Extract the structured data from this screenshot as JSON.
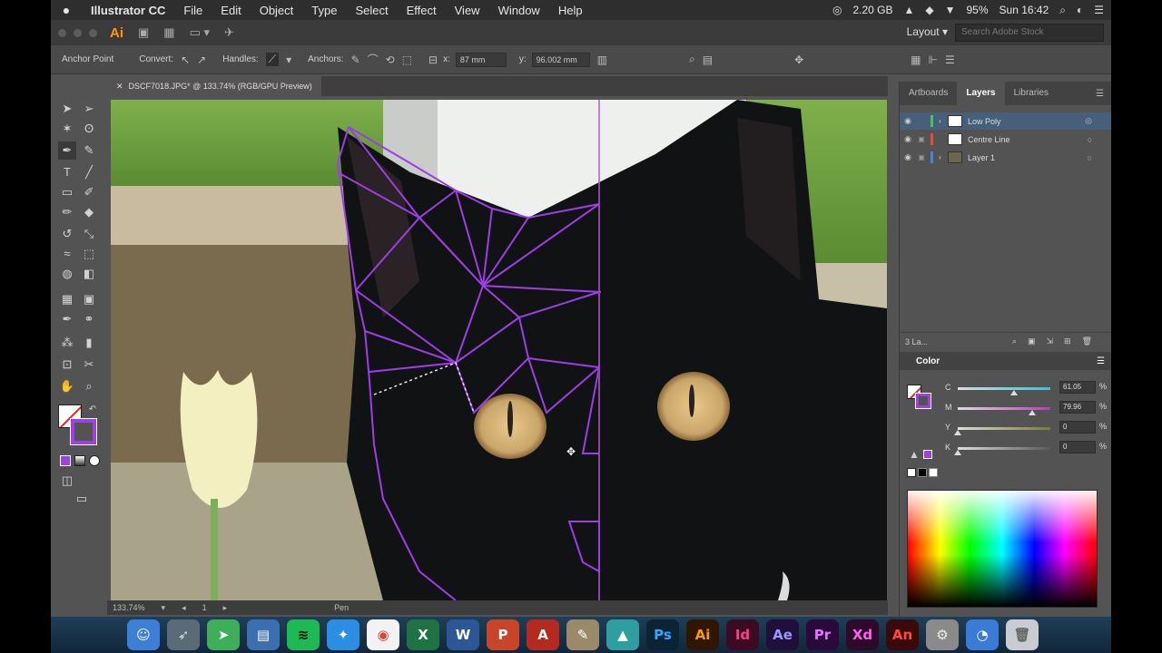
{
  "menubar": {
    "app_name": "Illustrator CC",
    "items": [
      "File",
      "Edit",
      "Object",
      "Type",
      "Select",
      "Effect",
      "View",
      "Window",
      "Help"
    ],
    "memory": "2.20 GB",
    "battery": "95%",
    "clock": "Sun 16:42"
  },
  "appbar": {
    "logo": "Ai",
    "workspace": "Layout",
    "search_placeholder": "Search Adobe Stock"
  },
  "controlbar": {
    "anchor_label": "Anchor Point",
    "convert_label": "Convert:",
    "handles_label": "Handles:",
    "anchors_label": "Anchors:",
    "x_value": "87 mm",
    "y_value": "96.002 mm"
  },
  "document": {
    "tab_title": "DSCF7018.JPG* @ 133.74% (RGB/GPU Preview)",
    "zoom": "133.74%",
    "artboard": "1",
    "status": "Pen"
  },
  "panels": {
    "tabs": [
      "Artboards",
      "Layers",
      "Libraries"
    ],
    "active_tab": "Layers",
    "layers": [
      {
        "name": "Low Poly",
        "color": "#4fbf56",
        "selected": true
      },
      {
        "name": "Centre Line",
        "color": "#e8473c",
        "selected": false
      },
      {
        "name": "Layer 1",
        "color": "#4f7fd8",
        "selected": false
      }
    ],
    "layers_count": "3 La..."
  },
  "color_panel": {
    "title": "Color",
    "channels": [
      {
        "ch": "C",
        "value": "61.05",
        "level": 0.61,
        "track": "#36c2d8"
      },
      {
        "ch": "M",
        "value": "79.96",
        "level": 0.8,
        "track": "#b83fb5"
      },
      {
        "ch": "Y",
        "value": "0",
        "level": 0.0,
        "track": "#7a7a3a"
      },
      {
        "ch": "K",
        "value": "0",
        "level": 0.0,
        "track": "#5a5a5a"
      }
    ],
    "pct": "%"
  },
  "dock": {
    "apps": [
      {
        "label": "☺",
        "bg": "#3d7fd6",
        "fg": "#fff",
        "name": "finder"
      },
      {
        "label": "➶",
        "bg": "#5a6a78",
        "fg": "#ddd",
        "name": "launchpad"
      },
      {
        "label": "➤",
        "bg": "#3fae5b",
        "fg": "#fff",
        "name": "telegram"
      },
      {
        "label": "▤",
        "bg": "#3b6fb0",
        "fg": "#fff",
        "name": "preview"
      },
      {
        "label": "≋",
        "bg": "#1db954",
        "fg": "#111",
        "name": "spotify"
      },
      {
        "label": "✦",
        "bg": "#2c8ee3",
        "fg": "#fff",
        "name": "safari"
      },
      {
        "label": "◉",
        "bg": "#f2f2f2",
        "fg": "#dd4433",
        "name": "chrome"
      },
      {
        "label": "X",
        "bg": "#1f7244",
        "fg": "#fff",
        "name": "excel"
      },
      {
        "label": "W",
        "bg": "#2b5797",
        "fg": "#fff",
        "name": "word"
      },
      {
        "label": "P",
        "bg": "#c9452a",
        "fg": "#fff",
        "name": "powerpoint"
      },
      {
        "label": "A",
        "bg": "#b52a1f",
        "fg": "#fff",
        "name": "acrobat"
      },
      {
        "label": "✎",
        "bg": "#9a8a6a",
        "fg": "#fff",
        "name": "pixelmator"
      },
      {
        "label": "▲",
        "bg": "#2f9ea0",
        "fg": "#fff",
        "name": "affinity"
      },
      {
        "label": "Ps",
        "bg": "#0a2433",
        "fg": "#31a8ff",
        "name": "photoshop"
      },
      {
        "label": "Ai",
        "bg": "#2e1600",
        "fg": "#ff9a00",
        "name": "illustrator"
      },
      {
        "label": "Id",
        "bg": "#3d0a24",
        "fg": "#ff3d8b",
        "name": "indesign"
      },
      {
        "label": "Ae",
        "bg": "#1f0f3a",
        "fg": "#9999ff",
        "name": "after-effects"
      },
      {
        "label": "Pr",
        "bg": "#2a0a3a",
        "fg": "#e077ff",
        "name": "premiere"
      },
      {
        "label": "Xd",
        "bg": "#2e0a2a",
        "fg": "#ff61f6",
        "name": "xd"
      },
      {
        "label": "An",
        "bg": "#3a0a0a",
        "fg": "#ff4a3d",
        "name": "animate"
      },
      {
        "label": "⚙",
        "bg": "#8a8a8a",
        "fg": "#eee",
        "name": "system-preferences"
      },
      {
        "label": "◔",
        "bg": "#3a7bd5",
        "fg": "#fff",
        "name": "migration"
      },
      {
        "label": "🗑",
        "bg": "#c9ccd1",
        "fg": "#666",
        "name": "trash"
      }
    ]
  }
}
